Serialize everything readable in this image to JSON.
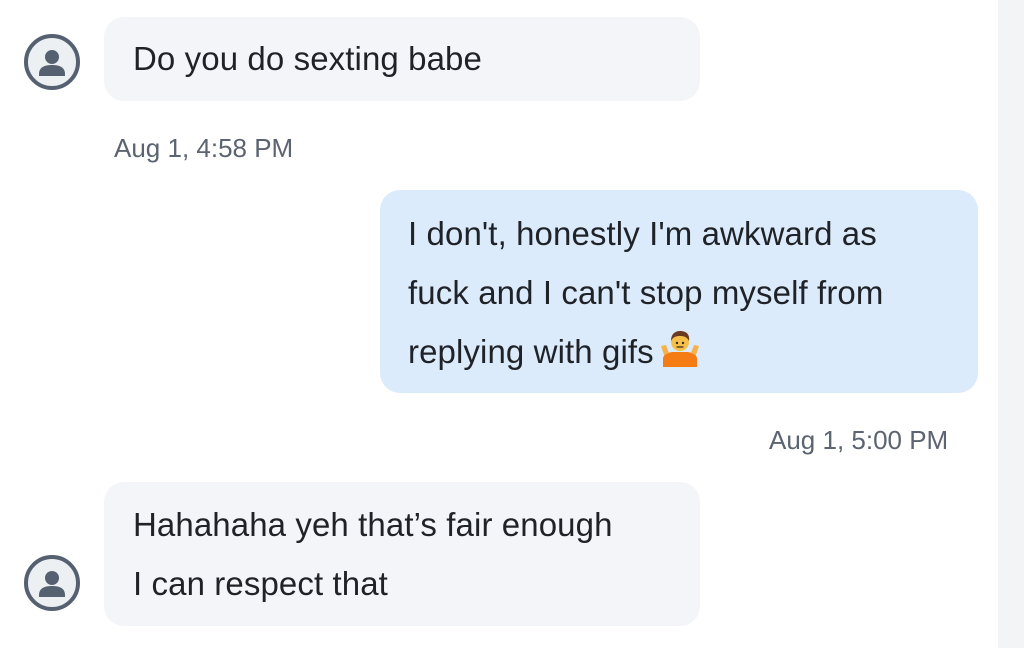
{
  "messages": [
    {
      "direction": "received",
      "lines": [
        "Do you do sexting babe"
      ],
      "timestamp": "Aug 1, 4:58 PM"
    },
    {
      "direction": "sent",
      "lines": [
        "I don't, honestly I'm awkward as",
        "fuck and I can't stop myself from",
        "replying with gifs"
      ],
      "emoji": "person-shrugging-emoji",
      "timestamp": "Aug 1, 5:00 PM"
    },
    {
      "direction": "received",
      "lines": [
        "Hahahaha yeh that’s fair enough",
        "I can respect that"
      ]
    }
  ],
  "colors": {
    "received_bubble": "#f4f5f8",
    "sent_bubble": "#dcebfb",
    "text": "#1f2328",
    "timestamp": "#5b6470",
    "avatar_ring": "#556070"
  }
}
